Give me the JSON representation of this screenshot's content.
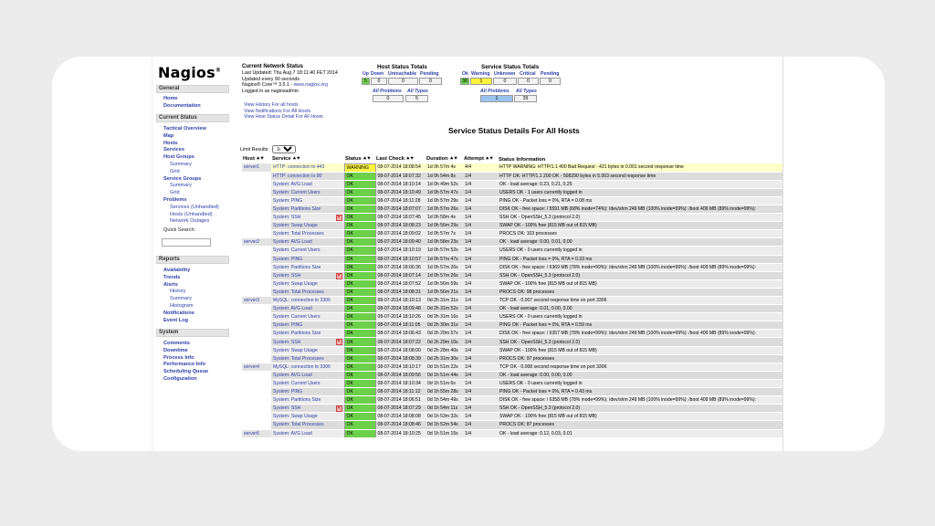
{
  "app": {
    "logo": "Nagios",
    "logo_mark": "®"
  },
  "sidebar": {
    "general_header": "General",
    "general": [
      "Home",
      "Documentation"
    ],
    "current_status_header": "Current Status",
    "current_status": [
      {
        "label": "Tactical Overview",
        "indent": 0
      },
      {
        "label": "Map",
        "indent": 0
      },
      {
        "label": "Hosts",
        "indent": 0
      },
      {
        "label": "Services",
        "indent": 0
      },
      {
        "label": "Host Groups",
        "indent": 0
      },
      {
        "label": "Summary",
        "indent": 1
      },
      {
        "label": "Grid",
        "indent": 1
      },
      {
        "label": "Service Groups",
        "indent": 0
      },
      {
        "label": "Summary",
        "indent": 1
      },
      {
        "label": "Grid",
        "indent": 1
      },
      {
        "label": "Problems",
        "indent": 0
      },
      {
        "label": "Services (Unhandled)",
        "indent": 1
      },
      {
        "label": "Hosts (Unhandled)",
        "indent": 1
      },
      {
        "label": "Network Outages",
        "indent": 1
      }
    ],
    "quick_search_label": "Quick Search:",
    "reports_header": "Reports",
    "reports": [
      {
        "label": "Availability",
        "indent": 0
      },
      {
        "label": "Trends",
        "indent": 0
      },
      {
        "label": "Alerts",
        "indent": 0
      },
      {
        "label": "History",
        "indent": 1
      },
      {
        "label": "Summary",
        "indent": 1
      },
      {
        "label": "Histogram",
        "indent": 1
      },
      {
        "label": "Notifications",
        "indent": 0
      },
      {
        "label": "Event Log",
        "indent": 0
      }
    ],
    "system_header": "System",
    "system": [
      "Comments",
      "Downtime",
      "Process Info",
      "Performance Info",
      "Scheduling Queue",
      "Configuration"
    ]
  },
  "network_status": {
    "title": "Current Network Status",
    "last_updated": "Last Updated: Thu Aug 7 18:11:40 FET 2014",
    "updated_every": "Updated every 90 seconds",
    "version_prefix": "Nagios® Core™ 3.5.1 - ",
    "version_link": "www.nagios.org",
    "logged_in": "Logged in as nagiosadmin",
    "links": [
      "View History For all hosts",
      "View Notifications For All Hosts",
      "View Host Status Detail For All Hosts"
    ]
  },
  "host_totals": {
    "title": "Host Status Totals",
    "headers": [
      "Up",
      "Down",
      "Unreachable",
      "Pending"
    ],
    "values": [
      "5",
      "0",
      "0",
      "0"
    ],
    "sub_headers": [
      "All Problems",
      "All Types"
    ],
    "sub_values": [
      "0",
      "5"
    ]
  },
  "service_totals": {
    "title": "Service Status Totals",
    "headers": [
      "Ok",
      "Warning",
      "Unknown",
      "Critical",
      "Pending"
    ],
    "values": [
      "38",
      "1",
      "0",
      "0",
      "0"
    ],
    "sub_headers": [
      "All Problems",
      "All Types"
    ],
    "sub_values": [
      "1",
      "39"
    ]
  },
  "page_title": "Service Status Details For All Hosts",
  "limit": {
    "label": "Limit Results:",
    "value": "100"
  },
  "table": {
    "columns": [
      "Host",
      "Service",
      "Status",
      "Last Check",
      "Duration",
      "Attempt",
      "Status Information"
    ],
    "sort_glyph": "⯅⯆",
    "rows": [
      {
        "host": "server1",
        "service": "HTTP: connection to 443",
        "status": "WARNING",
        "last": "08-07-2014 18:08:54",
        "dur": "1d 0h 57m 4s",
        "att": "4/4",
        "info": "HTTP WARNING: HTTP/1.1 400 Bad Request - 421 bytes in 0.001 second response time",
        "noti": false
      },
      {
        "host": "",
        "service": "HTTP: connection to 80",
        "status": "OK",
        "last": "08-07-2014 18:07:32",
        "dur": "1d 0h 54m 8s",
        "att": "1/4",
        "info": "HTTP OK: HTTP/1.1 200 OK - 508290 bytes in 5.003 second response time",
        "noti": false
      },
      {
        "host": "",
        "service": "System: AVG Load",
        "status": "OK",
        "last": "08-07-2014 18:10:14",
        "dur": "1d 0h 49m 52s",
        "att": "1/4",
        "info": "OK - load average: 0.23, 0.21, 0.25",
        "noti": false
      },
      {
        "host": "",
        "service": "System: Current Users",
        "status": "OK",
        "last": "08-07-2014 18:10:49",
        "dur": "1d 0h 57m 47s",
        "att": "1/4",
        "info": "USERS OK - 1 users currently logged in",
        "noti": false
      },
      {
        "host": "",
        "service": "System: PING",
        "status": "OK",
        "last": "08-07-2014 18:11:28",
        "dur": "1d 0h 57m 29s",
        "att": "1/4",
        "info": "PING OK - Packet loss = 0%, RTA = 0.08 ms",
        "noti": false
      },
      {
        "host": "",
        "service": "System: Partitions Size",
        "status": "OK",
        "last": "08-07-2014 18:07:07",
        "dur": "1d 0h 57m 26s",
        "att": "1/4",
        "info": "DISK OK - free space: / 5591 MB (68% inode=74%): /dev/shm 249 MB (100% inode=99%): /boot 409 MB (89% inode=99%):",
        "noti": false
      },
      {
        "host": "",
        "service": "System: SSH",
        "status": "OK",
        "last": "08-07-2014 18:07:45",
        "dur": "1d 0h 58m 4s",
        "att": "1/4",
        "info": "SSH OK - OpenSSH_5.3 (protocol 2.0)",
        "noti": true
      },
      {
        "host": "",
        "service": "System: Swap Usage",
        "status": "OK",
        "last": "08-07-2014 18:08:23",
        "dur": "1d 0h 56m 29s",
        "att": "1/4",
        "info": "SWAP OK - 100% free (815 MB out of 815 MB)",
        "noti": false
      },
      {
        "host": "",
        "service": "System: Total Processes",
        "status": "OK",
        "last": "08-07-2014 18:09:02",
        "dur": "1d 0h 57m 7s",
        "att": "1/4",
        "info": "PROCS OK: 103 processes",
        "noti": false
      },
      {
        "host": "server2",
        "service": "System: AVG Load",
        "status": "OK",
        "last": "08-07-2014 18:09:40",
        "dur": "1d 0h 58m 23s",
        "att": "1/4",
        "info": "OK - load average: 0.00, 0.01, 0.00",
        "noti": false
      },
      {
        "host": "",
        "service": "System: Current Users",
        "status": "OK",
        "last": "08-07-2014 18:10:19",
        "dur": "1d 0h 57m 52s",
        "att": "1/4",
        "info": "USERS OK - 0 users currently logged in",
        "noti": false
      },
      {
        "host": "",
        "service": "System: PING",
        "status": "OK",
        "last": "08-07-2014 18:10:57",
        "dur": "1d 0h 57m 47s",
        "att": "1/4",
        "info": "PING OK - Packet loss = 0%, RTA = 0.33 ms",
        "noti": false
      },
      {
        "host": "",
        "service": "System: Partitions Size",
        "status": "OK",
        "last": "08-07-2014 18:06:36",
        "dur": "1d 0h 57m 26s",
        "att": "1/4",
        "info": "DISK OK - free space: / 6369 MB (78% inode=99%): /dev/shm 249 MB (100% inode=99%): /boot 409 MB (89% inode=99%):",
        "noti": false
      },
      {
        "host": "",
        "service": "System: SSH",
        "status": "OK",
        "last": "08-07-2014 18:07:14",
        "dur": "1d 0h 57m 26s",
        "att": "1/4",
        "info": "SSH OK - OpenSSH_5.3 (protocol 2.0)",
        "noti": true
      },
      {
        "host": "",
        "service": "System: Swap Usage",
        "status": "OK",
        "last": "08-07-2014 18:07:52",
        "dur": "1d 0h 56m 59s",
        "att": "1/4",
        "info": "SWAP OK - 100% free (815 MB out of 815 MB)",
        "noti": false
      },
      {
        "host": "",
        "service": "System: Total Processes",
        "status": "OK",
        "last": "08-07-2014 18:08:31",
        "dur": "1d 0h 56m 21s",
        "att": "1/4",
        "info": "PROCS OK: 98 processes",
        "noti": false
      },
      {
        "host": "server3",
        "service": "MySQL: connection to 3306",
        "status": "OK",
        "last": "08-07-2014 18:10:13",
        "dur": "0d 2h 31m 31s",
        "att": "1/4",
        "info": "TCP OK - 0.007 second response time on port 3306",
        "noti": false
      },
      {
        "host": "",
        "service": "System: AVG Load",
        "status": "OK",
        "last": "08-07-2014 18:09:48",
        "dur": "0d 2h 31m 52s",
        "att": "1/4",
        "info": "OK - load average: 0.01, 0.00, 0.00",
        "noti": false
      },
      {
        "host": "",
        "service": "System: Current Users",
        "status": "OK",
        "last": "08-07-2014 18:10:26",
        "dur": "0d 2h 31m 16s",
        "att": "1/4",
        "info": "USERS OK - 0 users currently logged in",
        "noti": false
      },
      {
        "host": "",
        "service": "System: PING",
        "status": "OK",
        "last": "08-07-2014 18:11:05",
        "dur": "0d 2h 30m 31s",
        "att": "1/4",
        "info": "PING OK - Packet loss = 0%, RTA = 0.59 ms",
        "noti": false
      },
      {
        "host": "",
        "service": "System: Partitions Size",
        "status": "OK",
        "last": "08-07-2014 18:06:43",
        "dur": "0d 2h 29m 57s",
        "att": "1/4",
        "info": "DISK OK - free space: / 6357 MB (78% inode=99%): /dev/shm 249 MB (100% inode=99%): /boot 409 MB (89% inode=99%):",
        "noti": false
      },
      {
        "host": "",
        "service": "System: SSH",
        "status": "OK",
        "last": "08-07-2014 18:07:22",
        "dur": "0d 2h 29m 10s",
        "att": "1/4",
        "info": "SSH OK - OpenSSH_5.3 (protocol 2.0)",
        "noti": true
      },
      {
        "host": "",
        "service": "System: Swap Usage",
        "status": "OK",
        "last": "08-07-2014 18:08:00",
        "dur": "0d 2h 28m 40s",
        "att": "1/4",
        "info": "SWAP OK - 100% free (815 MB out of 815 MB)",
        "noti": false
      },
      {
        "host": "",
        "service": "System: Total Processes",
        "status": "OK",
        "last": "08-07-2014 18:08:39",
        "dur": "0d 2h 31m 30s",
        "att": "1/4",
        "info": "PROCS OK: 97 processes",
        "noti": false
      },
      {
        "host": "server4",
        "service": "MySQL: connection to 3306",
        "status": "OK",
        "last": "08-07-2014 18:10:17",
        "dur": "0d 1h 51m 22s",
        "att": "1/4",
        "info": "TCP OK - 0.008 second response time on port 3306",
        "noti": false
      },
      {
        "host": "",
        "service": "System: AVG Load",
        "status": "OK",
        "last": "08-07-2014 18:09:56",
        "dur": "0d 1h 51m 44s",
        "att": "1/4",
        "info": "OK - load average: 0.00, 0.00, 0.00",
        "noti": false
      },
      {
        "host": "",
        "service": "System: Current Users",
        "status": "OK",
        "last": "08-07-2014 18:10:34",
        "dur": "0d 1h 51m 6s",
        "att": "1/4",
        "info": "USERS OK - 0 users currently logged in",
        "noti": false
      },
      {
        "host": "",
        "service": "System: PING",
        "status": "OK",
        "last": "08-07-2014 18:11:12",
        "dur": "0d 1h 55m 28s",
        "att": "1/4",
        "info": "PING OK - Packet loss = 0%, RTA = 0.43 ms",
        "noti": false
      },
      {
        "host": "",
        "service": "System: Partitions Size",
        "status": "OK",
        "last": "08-07-2014 18:06:51",
        "dur": "0d 1h 54m 49s",
        "att": "1/4",
        "info": "DISK OK - free space: / 6358 MB (78% inode=99%): /dev/shm 249 MB (100% inode=99%): /boot 409 MB (89% inode=99%):",
        "noti": false
      },
      {
        "host": "",
        "service": "System: SSH",
        "status": "OK",
        "last": "08-07-2014 18:07:29",
        "dur": "0d 1h 54m 11s",
        "att": "1/4",
        "info": "SSH OK - OpenSSH_5.3 (protocol 2.0)",
        "noti": true
      },
      {
        "host": "",
        "service": "System: Swap Usage",
        "status": "OK",
        "last": "08-07-2014 18:08:08",
        "dur": "0d 1h 53m 32s",
        "att": "1/4",
        "info": "SWAP OK - 100% free (815 MB out of 815 MB)",
        "noti": false
      },
      {
        "host": "",
        "service": "System: Total Processes",
        "status": "OK",
        "last": "08-07-2014 18:08:46",
        "dur": "0d 1h 52m 54s",
        "att": "1/4",
        "info": "PROCS OK: 87 processes",
        "noti": false
      },
      {
        "host": "server5",
        "service": "System: AVG Load",
        "status": "OK",
        "last": "08-07-2014 18:10:25",
        "dur": "0d 1h 51m 15s",
        "att": "1/4",
        "info": "OK - load average: 0.12, 0.03, 0.01",
        "noti": false
      }
    ]
  },
  "colors": {
    "ok": "#6dd04b",
    "warning": "#fff43e",
    "link": "#2d3ea8",
    "selected": "#9ac2ef"
  }
}
